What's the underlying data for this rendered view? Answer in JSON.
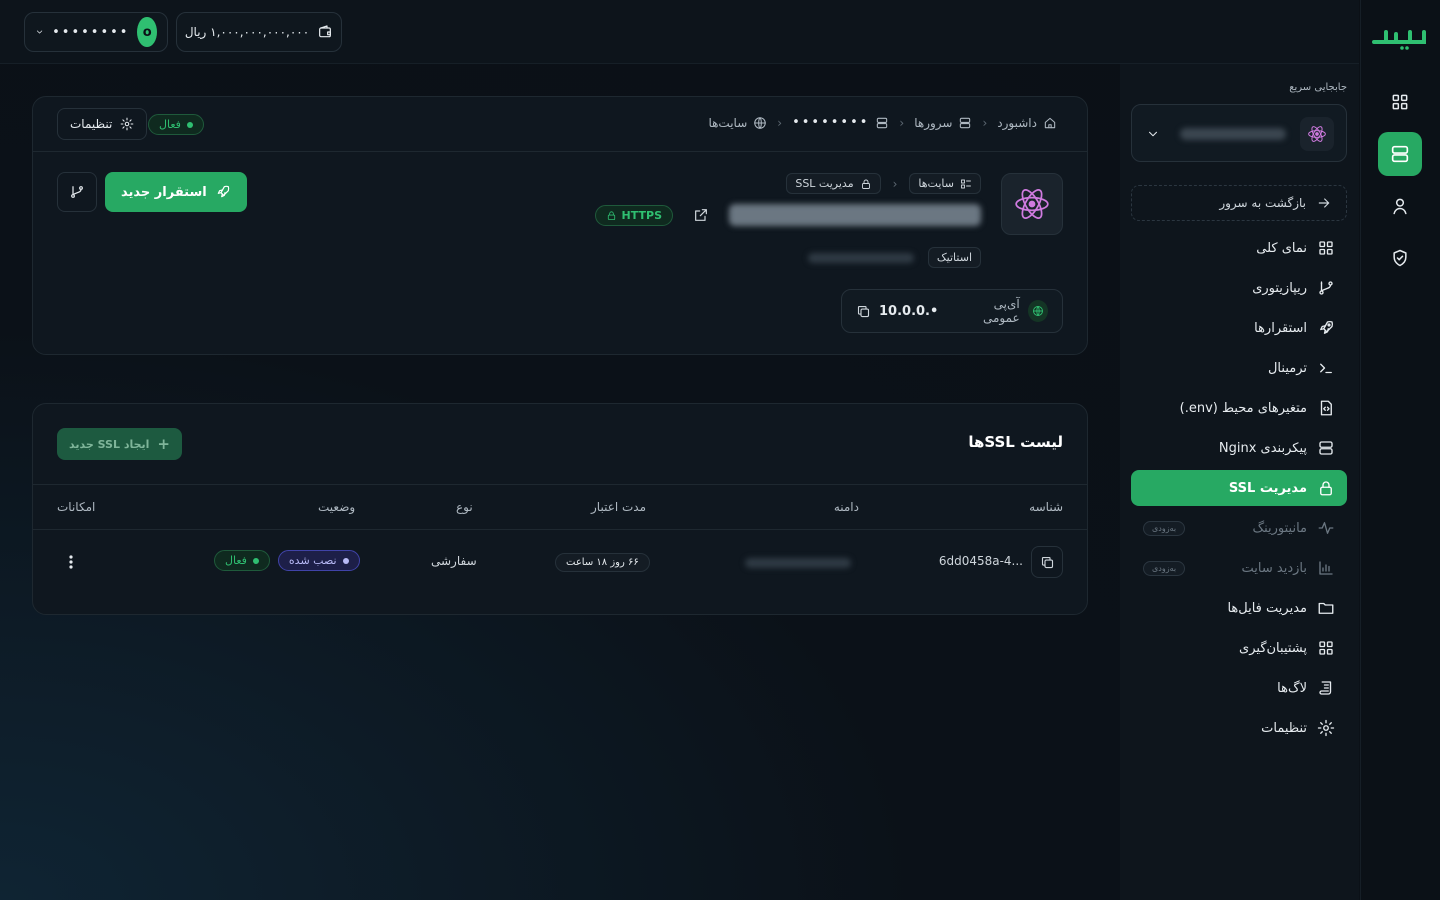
{
  "brand": {
    "accent": "#27a963",
    "logo_alt": "ابریا"
  },
  "topbar": {
    "wallet_label": "۱,۰۰۰,۰۰۰,۰۰۰,۰۰۰ ریال",
    "user_masked": "••••••••",
    "avatar_letter": "o"
  },
  "rail": {
    "icons": [
      "grid-icon",
      "server-icon",
      "user-icon",
      "shield-icon"
    ]
  },
  "sidebar": {
    "quick_switch_title": "جابجایی سریع",
    "back_label": "بازگشت به سرور",
    "items": [
      {
        "label": "نمای کلی",
        "icon": "grid-icon"
      },
      {
        "label": "ریپازیتوری",
        "icon": "branch-icon"
      },
      {
        "label": "استقرارها",
        "icon": "rocket-icon"
      },
      {
        "label": "ترمینال",
        "icon": "terminal-icon"
      },
      {
        "label": "متغیرهای محیط (env.)",
        "icon": "env-file-icon"
      },
      {
        "label": "پیکربندی Nginx",
        "icon": "server-icon"
      },
      {
        "label": "مدیریت SSL",
        "icon": "lock-icon"
      },
      {
        "label": "مانیتورینگ",
        "icon": "pulse-icon",
        "soon": "به‌زودی"
      },
      {
        "label": "بازدید سایت",
        "icon": "bar-chart-icon",
        "soon": "به‌زودی"
      },
      {
        "label": "مدیریت فایل‌ها",
        "icon": "folder-icon"
      },
      {
        "label": "پشتیبان‌گیری",
        "icon": "grid-icon"
      },
      {
        "label": "لاگ‌ها",
        "icon": "scroll-icon"
      },
      {
        "label": "تنظیمات",
        "icon": "gear-icon"
      }
    ]
  },
  "header": {
    "breadcrumbs": [
      "داشبورد",
      "سرورها",
      "••••••••",
      "سایت‌ها"
    ],
    "status": "فعال",
    "settings_label": "تنظیمات"
  },
  "site": {
    "tag_sites": "سایت‌ها",
    "tag_ssl": "مدیریت SSL",
    "https_label": "HTTPS",
    "type_label": "استاتیک",
    "ip_label": "آی‌پی عمومی",
    "ip_value": "10.0.0.•",
    "deploy_label": "استقرار جدید"
  },
  "ssl": {
    "title": "لیست SSLها",
    "new_button": "ایجاد SSL جدید",
    "columns": [
      "شناسه",
      "دامنه",
      "مدت اعتبار",
      "نوع",
      "وضعیت",
      "امکانات"
    ],
    "rows": [
      {
        "id": "6dd0458a-4...",
        "validity": "۶۶ روز ۱۸ ساعت",
        "type": "سفارشی",
        "status": "فعال",
        "install": "نصب شده"
      }
    ]
  }
}
